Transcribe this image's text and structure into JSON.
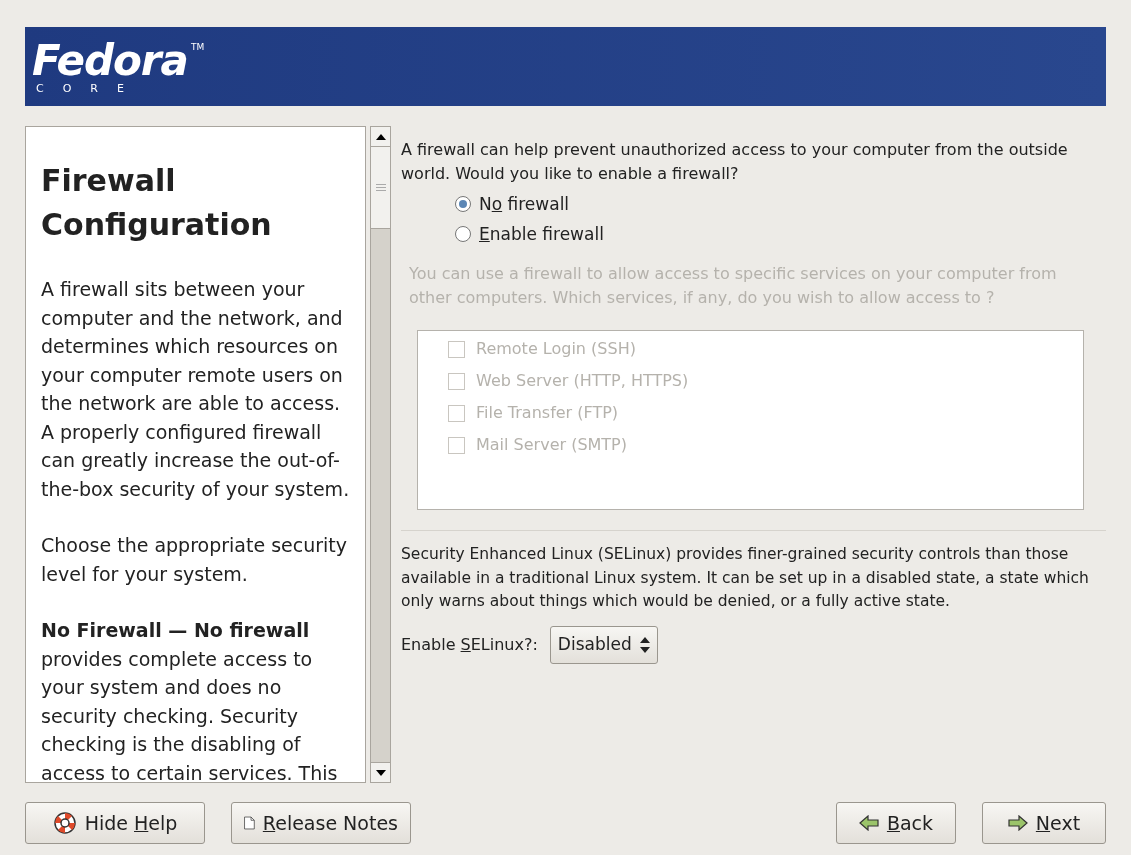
{
  "banner": {
    "logo": "Fedora",
    "trademark": "TM",
    "subtitle": [
      "C",
      "O",
      "R",
      "E"
    ]
  },
  "help": {
    "title": "Firewall Configuration",
    "paragraphs": [
      "A firewall sits between your computer and the network, and determines which resources on your computer remote users on the network are able to access. A properly configured firewall can greatly increase the out-of-the-box security of your system.",
      "Choose the appropriate security level for your system.",
      "**No Firewall — No firewall** provides complete access to your system and does no security checking. Security checking is the disabling of access to certain services. This"
    ]
  },
  "firewall": {
    "question": "A firewall can help prevent unauthorized access to your computer from the outside world.  Would you like to enable a firewall?",
    "options": [
      {
        "pre": "N",
        "key": "o",
        "post": " firewall",
        "selected": true
      },
      {
        "key": "E",
        "post": "nable firewall",
        "selected": false
      }
    ],
    "services_note": "You can use a firewall to allow access to specific services on your computer from other computers. Which services, if any, do you wish to allow access to ?",
    "services_disabled": true,
    "services": [
      {
        "label": "Remote Login (SSH)",
        "checked": false
      },
      {
        "label": "Web Server (HTTP, HTTPS)",
        "checked": false
      },
      {
        "label": "File Transfer (FTP)",
        "checked": false
      },
      {
        "label": "Mail Server (SMTP)",
        "checked": false
      }
    ]
  },
  "selinux": {
    "description": "Security Enhanced Linux (SELinux) provides finer-grained security controls than those available in a traditional Linux system.  It can be set up in a disabled state, a state which only warns about things which would be denied, or a fully active state.",
    "label": {
      "pre": "Enable ",
      "key": "S",
      "post": "ELinux?:"
    },
    "value": "Disabled"
  },
  "buttons": [
    {
      "kind": "help",
      "pre": "Hide ",
      "key": "H",
      "post": "elp"
    },
    {
      "kind": "notes",
      "key": "R",
      "post": "elease Notes"
    },
    {
      "kind": "back",
      "key": "B",
      "post": "ack"
    },
    {
      "kind": "next",
      "key": "N",
      "post": "ext"
    }
  ]
}
